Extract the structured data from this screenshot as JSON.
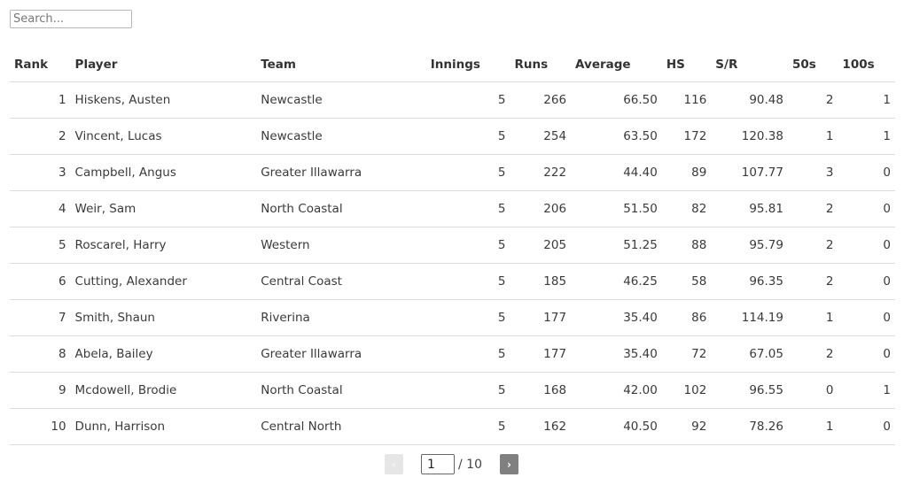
{
  "search": {
    "placeholder": "Search...",
    "value": ""
  },
  "table": {
    "columns": [
      "Rank",
      "Player",
      "Team",
      "Innings",
      "Runs",
      "Average",
      "HS",
      "S/R",
      "50s",
      "100s"
    ],
    "rows": [
      {
        "rank": "1",
        "player": "Hiskens, Austen",
        "team": "Newcastle",
        "innings": "5",
        "runs": "266",
        "average": "66.50",
        "hs": "116",
        "sr": "90.48",
        "fifties": "2",
        "hundreds": "1"
      },
      {
        "rank": "2",
        "player": "Vincent, Lucas",
        "team": "Newcastle",
        "innings": "5",
        "runs": "254",
        "average": "63.50",
        "hs": "172",
        "sr": "120.38",
        "fifties": "1",
        "hundreds": "1"
      },
      {
        "rank": "3",
        "player": "Campbell, Angus",
        "team": "Greater Illawarra",
        "innings": "5",
        "runs": "222",
        "average": "44.40",
        "hs": "89",
        "sr": "107.77",
        "fifties": "3",
        "hundreds": "0"
      },
      {
        "rank": "4",
        "player": "Weir, Sam",
        "team": "North Coastal",
        "innings": "5",
        "runs": "206",
        "average": "51.50",
        "hs": "82",
        "sr": "95.81",
        "fifties": "2",
        "hundreds": "0"
      },
      {
        "rank": "5",
        "player": "Roscarel, Harry",
        "team": "Western",
        "innings": "5",
        "runs": "205",
        "average": "51.25",
        "hs": "88",
        "sr": "95.79",
        "fifties": "2",
        "hundreds": "0"
      },
      {
        "rank": "6",
        "player": "Cutting, Alexander",
        "team": "Central Coast",
        "innings": "5",
        "runs": "185",
        "average": "46.25",
        "hs": "58",
        "sr": "96.35",
        "fifties": "2",
        "hundreds": "0"
      },
      {
        "rank": "7",
        "player": "Smith, Shaun",
        "team": "Riverina",
        "innings": "5",
        "runs": "177",
        "average": "35.40",
        "hs": "86",
        "sr": "114.19",
        "fifties": "1",
        "hundreds": "0"
      },
      {
        "rank": "8",
        "player": "Abela, Bailey",
        "team": "Greater Illawarra",
        "innings": "5",
        "runs": "177",
        "average": "35.40",
        "hs": "72",
        "sr": "67.05",
        "fifties": "2",
        "hundreds": "0"
      },
      {
        "rank": "9",
        "player": "Mcdowell, Brodie",
        "team": "North Coastal",
        "innings": "5",
        "runs": "168",
        "average": "42.00",
        "hs": "102",
        "sr": "96.55",
        "fifties": "0",
        "hundreds": "1"
      },
      {
        "rank": "10",
        "player": "Dunn, Harrison",
        "team": "Central North",
        "innings": "5",
        "runs": "162",
        "average": "40.50",
        "hs": "92",
        "sr": "78.26",
        "fifties": "1",
        "hundreds": "0"
      }
    ]
  },
  "pagination": {
    "prev_label": "‹",
    "next_label": "›",
    "current_page": "1",
    "total_label": "/ 10"
  }
}
